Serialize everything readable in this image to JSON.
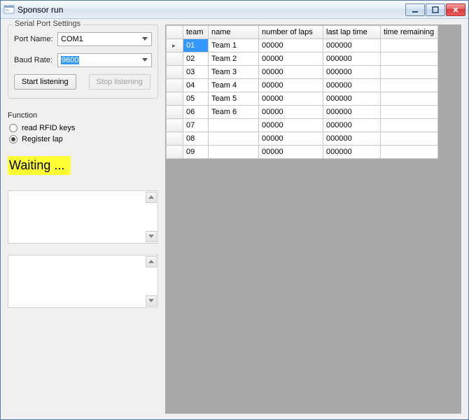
{
  "window": {
    "title": "Sponsor run"
  },
  "serial": {
    "group_title": "Serial Port Settings",
    "port_label": "Port Name:",
    "port_value": "COM1",
    "baud_label": "Baud Rate:",
    "baud_value": "9600",
    "start_btn": "Start listening",
    "stop_btn": "Stop listening"
  },
  "function": {
    "heading": "Function",
    "opt_read": "read RFID keys",
    "opt_register": "Register lap",
    "selected": "register"
  },
  "status_text": "Waiting ...",
  "grid": {
    "columns": {
      "team": "team",
      "name": "name",
      "laps": "number of laps",
      "last": "last lap time",
      "time": "time remaining"
    },
    "rows": [
      {
        "team": "01",
        "name": "Team 1",
        "laps": "00000",
        "last": "000000",
        "time": ""
      },
      {
        "team": "02",
        "name": "Team 2",
        "laps": "00000",
        "last": "000000",
        "time": ""
      },
      {
        "team": "03",
        "name": "Team 3",
        "laps": "00000",
        "last": "000000",
        "time": ""
      },
      {
        "team": "04",
        "name": "Team 4",
        "laps": "00000",
        "last": "000000",
        "time": ""
      },
      {
        "team": "05",
        "name": "Team 5",
        "laps": "00000",
        "last": "000000",
        "time": ""
      },
      {
        "team": "06",
        "name": "Team 6",
        "laps": "00000",
        "last": "000000",
        "time": ""
      },
      {
        "team": "07",
        "name": "",
        "laps": "00000",
        "last": "000000",
        "time": ""
      },
      {
        "team": "08",
        "name": "",
        "laps": "00000",
        "last": "000000",
        "time": ""
      },
      {
        "team": "09",
        "name": "",
        "laps": "00000",
        "last": "000000",
        "time": ""
      }
    ]
  }
}
